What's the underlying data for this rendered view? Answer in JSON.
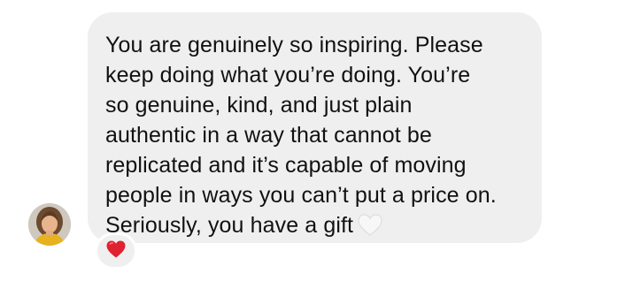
{
  "message": {
    "text": "You are genuinely so inspiring. Please\nkeep doing what you’re doing. You’re\nso genuine, kind, and just plain\nauthentic in a way that cannot be\nreplicated and it’s capable of moving\npeople in ways you can’t put a price on.\nSeriously, you have a gift",
    "inline_emoji": "white-heart-icon"
  },
  "reaction": {
    "emoji": "red-heart-icon",
    "color": "#e0212f"
  },
  "colors": {
    "bubble_background": "#efefef",
    "text": "#111111"
  }
}
